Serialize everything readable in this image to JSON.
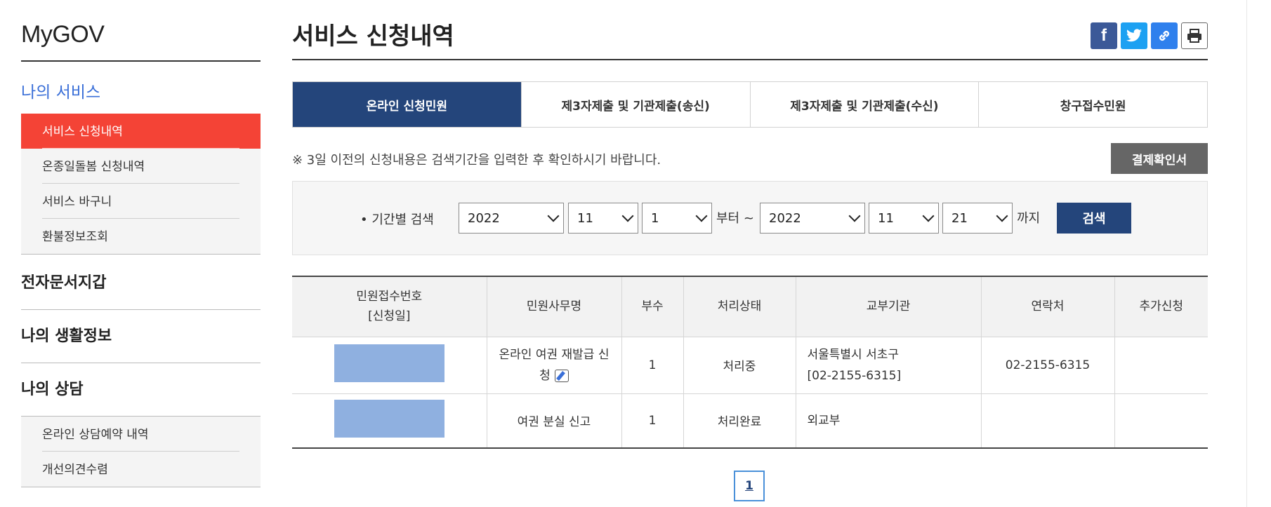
{
  "sidebar": {
    "brand": "MyGOV",
    "section_title": "나의 서비스",
    "service_items": [
      {
        "label": "서비스 신청내역",
        "active": true
      },
      {
        "label": "온종일돌봄 신청내역"
      },
      {
        "label": "서비스 바구니"
      },
      {
        "label": "환불정보조회"
      }
    ],
    "sections": [
      "전자문서지갑",
      "나의 생활정보",
      "나의 상담"
    ],
    "consult_items": [
      {
        "label": "온라인 상담예약 내역"
      },
      {
        "label": "개선의견수렴"
      }
    ]
  },
  "main": {
    "title": "서비스 신청내역",
    "share_icons": [
      "facebook-icon",
      "twitter-icon",
      "link-icon",
      "print-icon"
    ],
    "tabs": [
      {
        "label": "온라인 신청민원",
        "active": true
      },
      {
        "label": "제3자제출 및 기관제출(송신)"
      },
      {
        "label": "제3자제출 및 기관제출(수신)"
      },
      {
        "label": "창구접수민원"
      }
    ],
    "notice": "※ 3일 이전의 신청내용은 검색기간을 입력한 후 확인하시기 바랍니다.",
    "confirm_button": "결제확인서",
    "search": {
      "label": "• 기간별 검색",
      "from_year": "2022",
      "from_month": "11",
      "from_day": "1",
      "from_word": "부터 ~",
      "to_year": "2022",
      "to_month": "11",
      "to_day": "21",
      "to_word": "까지",
      "button": "검색"
    },
    "table": {
      "headers": [
        "민원접수번호",
        "[신청일]",
        "민원사무명",
        "부수",
        "처리상태",
        "교부기관",
        "연락처",
        "추가신청"
      ],
      "rows": [
        {
          "name_line1": "온라인 여권 재발급 신",
          "name_line2": "청",
          "copies": "1",
          "status": "처리중",
          "agency_line1": "서울특별시 서초구",
          "agency_line2": "[02-2155-6315]",
          "contact": "02-2155-6315",
          "extra": ""
        },
        {
          "name_line1": "여권 분실 신고",
          "copies": "1",
          "status": "처리완료",
          "agency_line1": "외교부",
          "contact": "",
          "extra": ""
        }
      ]
    },
    "pagination": {
      "current": "1"
    }
  },
  "colors": {
    "active_menu": "#f44336",
    "active_tab": "#24457b",
    "section_title": "#3a6fd8",
    "masked": "#8fb0e0"
  }
}
